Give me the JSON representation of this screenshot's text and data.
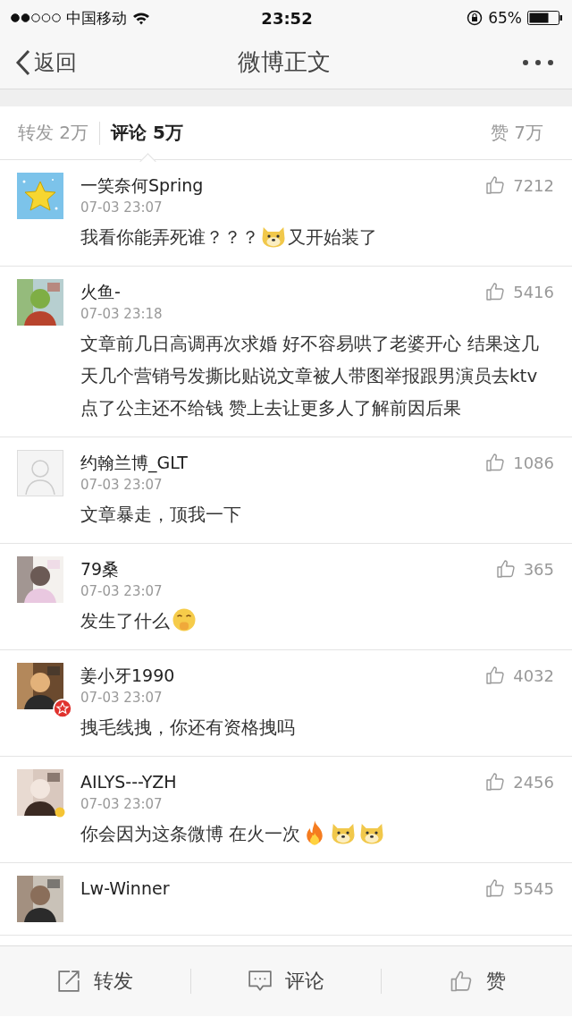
{
  "status_bar": {
    "carrier": "中国移动",
    "time": "23:52",
    "battery": "65%"
  },
  "nav": {
    "back": "返回",
    "title": "微博正文"
  },
  "tabs": [
    {
      "label": "转发 2万",
      "selected": false
    },
    {
      "label": "评论 5万",
      "selected": true
    },
    {
      "label": "赞 7万",
      "selected": false
    }
  ],
  "comments": [
    {
      "avatar": {
        "kind": "picture"
      },
      "user": "一笑奈何Spring",
      "time": "07-03 23:07",
      "likes": "7212",
      "body": [
        {
          "kind": "text",
          "text": "我看你能弄死谁？？？"
        },
        {
          "kind": "dog"
        },
        {
          "kind": "text",
          "text": "又开始装了"
        }
      ]
    },
    {
      "avatar": {
        "kind": "picture"
      },
      "user": "火鱼-",
      "time": "07-03 23:18",
      "likes": "5416",
      "body": [
        {
          "kind": "text",
          "text": "文章前几日高调再次求婚 好不容易哄了老婆开心 结果这几天几个营销号发撕比贴说文章被人带图举报跟男演员去ktv点了公主还不给钱  赞上去让更多人了解前因后果"
        }
      ]
    },
    {
      "avatar": {
        "kind": "default"
      },
      "user": "约翰兰博_GLT",
      "time": "07-03 23:07",
      "likes": "1086",
      "body": [
        {
          "kind": "text",
          "text": "文章暴走，顶我一下"
        }
      ]
    },
    {
      "avatar": {
        "kind": "picture"
      },
      "user": "79桑",
      "time": "07-03 23:07",
      "likes": "365",
      "body": [
        {
          "kind": "text",
          "text": "发生了什么"
        },
        {
          "kind": "shush"
        }
      ]
    },
    {
      "avatar": {
        "kind": "picture",
        "badge": {
          "kind": "star"
        }
      },
      "user": "姜小牙1990",
      "time": "07-03 23:07",
      "likes": "4032",
      "body": [
        {
          "kind": "text",
          "text": "拽毛线拽，你还有资格拽吗"
        }
      ]
    },
    {
      "avatar": {
        "kind": "picture",
        "badge": {
          "kind": "dot"
        }
      },
      "user": "AILYS---YZH",
      "time": "07-03 23:07",
      "likes": "2456",
      "body": [
        {
          "kind": "text",
          "text": "你会因为这条微博 在火一次"
        },
        {
          "kind": "fire"
        },
        {
          "kind": "dog"
        },
        {
          "kind": "dog"
        }
      ]
    },
    {
      "avatar": {
        "kind": "picture"
      },
      "user": "Lw-Winner",
      "likes": "5545"
    }
  ],
  "toolbar": [
    {
      "kind": "repost",
      "label": "转发"
    },
    {
      "kind": "comment",
      "label": "评论"
    },
    {
      "kind": "like",
      "label": "赞"
    }
  ]
}
